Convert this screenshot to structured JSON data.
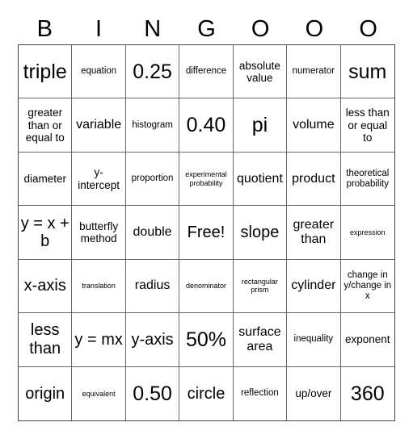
{
  "header": {
    "letters": [
      "B",
      "I",
      "N",
      "G",
      "O",
      "O",
      "O"
    ]
  },
  "board": {
    "rows": [
      [
        "triple",
        "equation",
        "0.25",
        "difference",
        "absolute value",
        "numerator",
        "sum"
      ],
      [
        "greater than or equal to",
        "variable",
        "histogram",
        "0.40",
        "pi",
        "volume",
        "less than or equal to"
      ],
      [
        "diameter",
        "y-intercept",
        "proportion",
        "experimental probability",
        "quotient",
        "product",
        "theoretical probability"
      ],
      [
        "y = x + b",
        "butterfly method",
        "double",
        "Free!",
        "slope",
        "greater than",
        "expression"
      ],
      [
        "x-axis",
        "translation",
        "radius",
        "denominator",
        "rectangular prism",
        "cylinder",
        "change in y/change in x"
      ],
      [
        "less than",
        "y = mx",
        "y-axis",
        "50%",
        "surface area",
        "inequality",
        "exponent"
      ],
      [
        "origin",
        "equivalent",
        "0.50",
        "circle",
        "reflection",
        "up/over",
        "360"
      ]
    ],
    "free_space": "Free!"
  }
}
